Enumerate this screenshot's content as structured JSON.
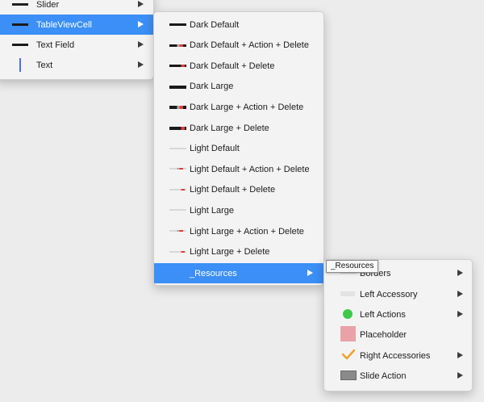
{
  "menu1": {
    "items": [
      {
        "label": "Slider",
        "icon": "slider-icon"
      },
      {
        "label": "TableViewCell",
        "icon": "table-view-cell-icon",
        "selected": true
      },
      {
        "label": "Text Field",
        "icon": "text-field-icon"
      },
      {
        "label": "Text",
        "icon": "text-cursor-icon"
      }
    ]
  },
  "menu2": {
    "items": [
      {
        "label": "Dark Default"
      },
      {
        "label": "Dark Default + Action + Delete"
      },
      {
        "label": "Dark Default + Delete"
      },
      {
        "label": "Dark Large"
      },
      {
        "label": "Dark Large + Action + Delete"
      },
      {
        "label": "Dark Large + Delete"
      },
      {
        "label": "Light Default"
      },
      {
        "label": "Light Default + Action + Delete"
      },
      {
        "label": "Light Default + Delete"
      },
      {
        "label": "Light Large"
      },
      {
        "label": "Light Large + Action + Delete"
      },
      {
        "label": "Light Large + Delete"
      },
      {
        "label": "_Resources",
        "selected": true
      }
    ]
  },
  "menu3": {
    "items": [
      {
        "label": "Borders",
        "icon": "borders-icon"
      },
      {
        "label": "Left Accessory",
        "icon": "left-accessory-icon"
      },
      {
        "label": "Left Actions",
        "icon": "green-circle-icon"
      },
      {
        "label": "Placeholder",
        "icon": "pink-square-icon"
      },
      {
        "label": "Right Accessories",
        "icon": "checkmark-icon"
      },
      {
        "label": "Slide Action",
        "icon": "slide-action-icon"
      }
    ]
  },
  "tooltip": {
    "text": "_Resources"
  },
  "colors": {
    "selection": "#3b8ff6",
    "menu_bg": "#f3f3f3",
    "green": "#3ec94a",
    "pink": "#e8a2a8",
    "orange": "#f0a030"
  }
}
